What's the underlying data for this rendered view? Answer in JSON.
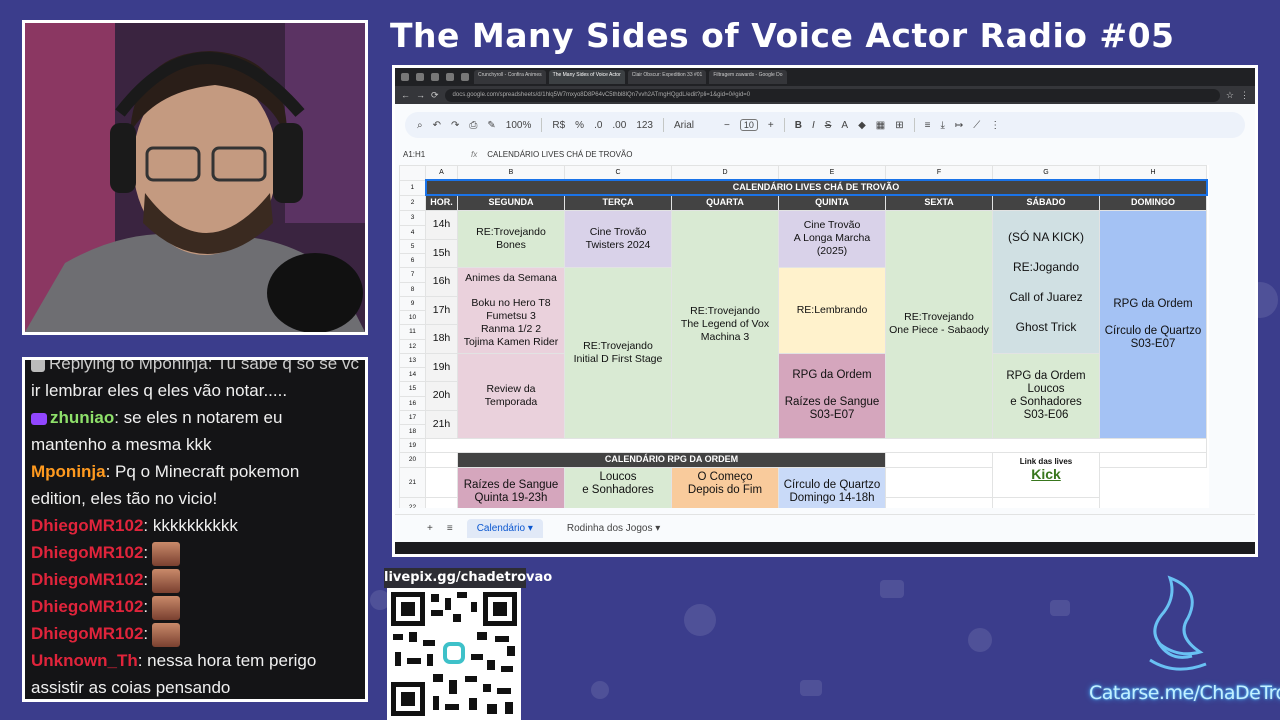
{
  "stream": {
    "title": "The Many Sides of Voice Actor Radio #05",
    "livepix_label": "livepix.gg/chadetrovao",
    "catarse_label": "Catarse.me/ChaDeTrovao"
  },
  "chat": {
    "messages": [
      {
        "user": "",
        "text": "Replying to Mponinja: Tu sabe q só se vc",
        "color": "#cccccc"
      },
      {
        "user": "",
        "text": "ir lembrar eles q eles vão notar.....",
        "color": "#f0f0f0"
      },
      {
        "user": "zhuniao",
        "text": ": se eles n notarem eu",
        "color": "#8ee06a"
      },
      {
        "user": "",
        "text": "mantenho a mesma kkk",
        "color": "#f0f0f0"
      },
      {
        "user": "Mponinja",
        "text": ": Pq o Minecraft pokemon",
        "color": "#ff9a1f"
      },
      {
        "user": "",
        "text": "edition, eles tão no vicio!",
        "color": "#f0f0f0"
      },
      {
        "user": "DhiegoMR102",
        "text": ": kkkkkkkkkk",
        "color": "#e0243b"
      },
      {
        "user": "DhiegoMR102",
        "text": ":",
        "color": "#e0243b",
        "emote": true
      },
      {
        "user": "DhiegoMR102",
        "text": ":",
        "color": "#e0243b",
        "emote": true
      },
      {
        "user": "DhiegoMR102",
        "text": ":",
        "color": "#e0243b",
        "emote": true
      },
      {
        "user": "DhiegoMR102",
        "text": ":",
        "color": "#e0243b",
        "emote": true
      },
      {
        "user": "Unknown_Th",
        "text": ": nessa hora tem perigo",
        "color": "#e0243b"
      },
      {
        "user": "",
        "text": "assistir as coias pensando",
        "color": "#f0f0f0"
      }
    ]
  },
  "browser": {
    "tabs": [
      "Crunchyroll - Confira Animes",
      "The Many Sides of Voice Actor",
      "Clair Obscur: Expedition 33 #01",
      "Filtragem zawards - Google Do"
    ],
    "url": "docs.google.com/spreadsheets/d/1hlq5W7mxyo8D8P64vC5thbl8lQn7vvh2ATmgHQgdL/edit?pli=1&gid=0#gid=0"
  },
  "sheets_toolbar": {
    "zoom": "100%",
    "currency": "R$",
    "percent": "%",
    "dec_less": ".0",
    "dec_more": ".00",
    "number": "123",
    "font": "Arial",
    "font_size": "10",
    "bold": "B",
    "italic": "I"
  },
  "formula_bar": {
    "namebox": "A1:H1",
    "formula": "CALENDÁRIO LIVES CHÁ DE TROVÃO"
  },
  "sheet": {
    "col_headers": [
      "A",
      "B",
      "C",
      "D",
      "E",
      "F",
      "G",
      "H"
    ],
    "row_numbers": [
      "1",
      "2",
      "3",
      "4",
      "5",
      "6",
      "7",
      "8",
      "9",
      "10",
      "11",
      "12",
      "13",
      "14",
      "15",
      "16",
      "17",
      "18",
      "19",
      "20",
      "21",
      "22"
    ],
    "title": "CALENDÁRIO LIVES CHÁ DE TROVÃO",
    "day_headers": [
      "HOR.",
      "SEGUNDA",
      "TERÇA",
      "QUARTA",
      "QUINTA",
      "SEXTA",
      "SÁBADO",
      "DOMINGO"
    ],
    "hours": [
      "14h",
      "15h",
      "16h",
      "17h",
      "18h",
      "19h",
      "20h",
      "21h"
    ],
    "segunda": {
      "block1": [
        "RE:Trovejando",
        "Bones"
      ],
      "block2": [
        "Animes da Semana"
      ],
      "block3": [
        "Boku no Hero T8",
        "Fumetsu 3",
        "Ranma 1/2 2",
        "Tojima Kamen Rider"
      ],
      "block4": [
        "Review da",
        "Temporada"
      ]
    },
    "terca": {
      "block1": [
        "Cine Trovão",
        "Twisters 2024"
      ],
      "block2": [
        "RE:Trovejando",
        "Initial D First Stage"
      ]
    },
    "quarta": {
      "block1": [
        "RE:Trovejando",
        "The Legend of Vox",
        "Machina 3"
      ]
    },
    "quinta": {
      "block1": [
        "Cine Trovão",
        "A Longa Marcha",
        "(2025)"
      ],
      "block2": [
        "RE:Lembrando"
      ],
      "block3": [
        "RPG da Ordem"
      ],
      "block4": [
        "Raízes de Sangue",
        "S03-E07"
      ]
    },
    "sexta": {
      "block1": [
        "RE:Trovejando",
        "One Piece - Sabaody"
      ]
    },
    "sabado": {
      "block1": [
        "(SÓ NA KICK)"
      ],
      "block2": [
        "RE:Jogando"
      ],
      "block3": [
        "Call of Juarez"
      ],
      "block4": [
        "Ghost Trick"
      ],
      "block5": [
        "RPG da Ordem",
        "Loucos",
        "e Sonhadores",
        "S03-E06"
      ]
    },
    "domingo": {
      "block1": [
        "RPG da Ordem"
      ],
      "block2": [
        "Círculo de Quartzo",
        "S03-E07"
      ]
    },
    "rpg_title": "CALENDÁRIO RPG DA ORDEM",
    "rpg_cells": [
      [
        "Raízes de Sangue",
        "Quinta 19-23h"
      ],
      [
        "Loucos",
        "e Sonhadores"
      ],
      [
        "O Começo",
        "Depois do Fim"
      ],
      [
        "Círculo de Quartzo",
        "Domingo 14-18h"
      ]
    ],
    "links_title": "Link das lives",
    "kick_link": "Kick"
  },
  "sheet_tabs": {
    "add": "+",
    "menu": "≡",
    "tab1": "Calendário",
    "tab2": "Rodinha dos Jogos"
  },
  "colors": {
    "background": "#3b3d8c",
    "header_dark": "#434343",
    "green": "#d9ead3",
    "purple": "#d9d2e9",
    "pink": "#ead1dc",
    "yellow": "#fff2cc",
    "mauve": "#d5a6bd",
    "blue": "#a4c2f4"
  }
}
